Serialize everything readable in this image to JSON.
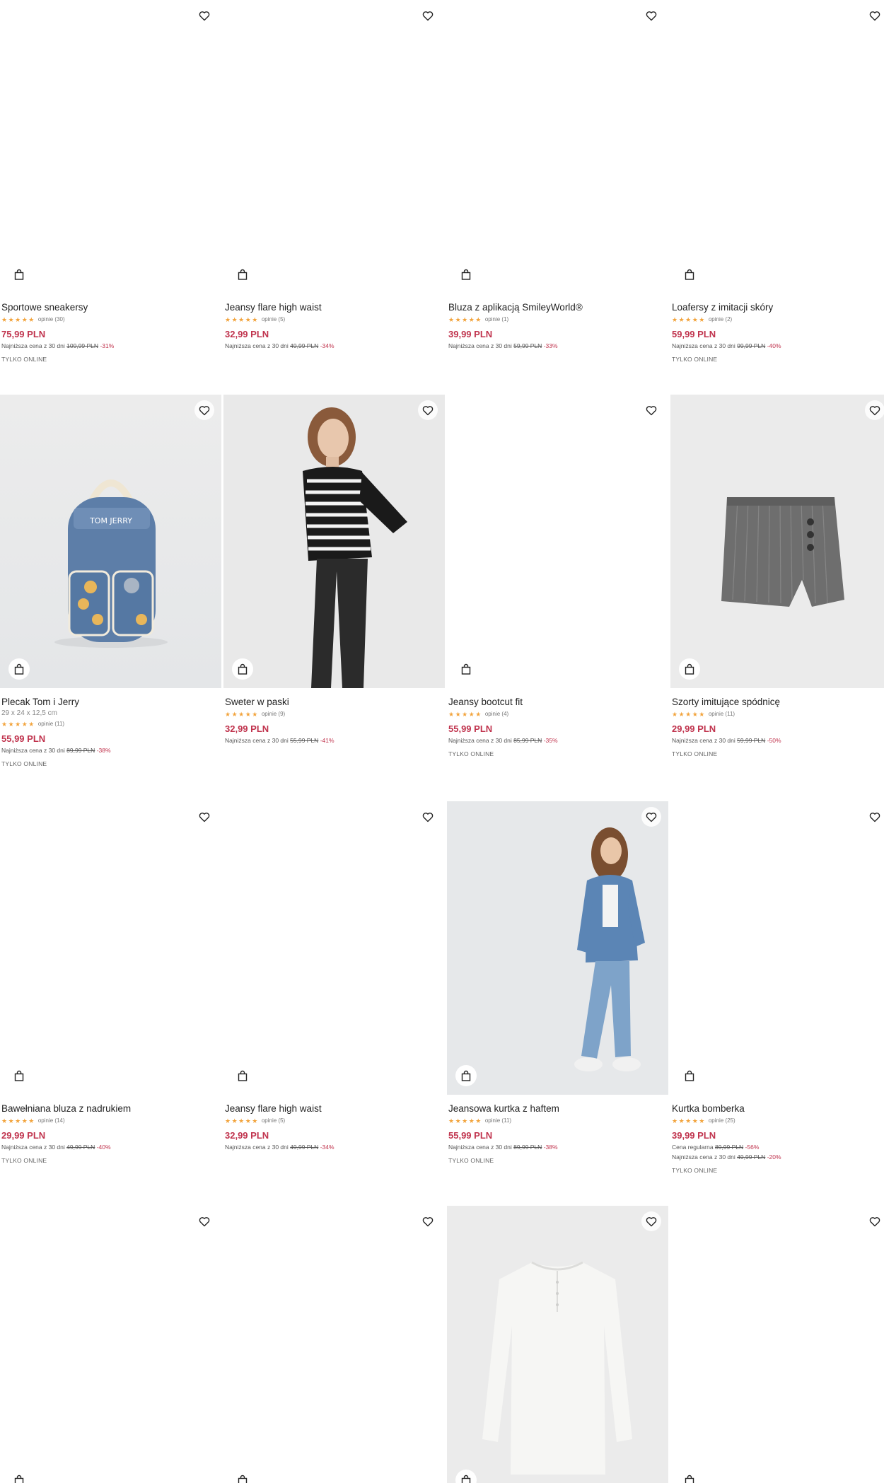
{
  "products": [
    {
      "name": "Sportowe sneakersy",
      "reviews": "opinie (30)",
      "price": "75,99 PLN",
      "lowest_label": "Najniższa cena z 30 dni",
      "lowest_price": "109,99 PLN",
      "lowest_pct": "-31%",
      "badge": "TYLKO ONLINE"
    },
    {
      "name": "Jeansy flare high waist",
      "reviews": "opinie (5)",
      "price": "32,99 PLN",
      "lowest_label": "Najniższa cena z 30 dni",
      "lowest_price": "49,99 PLN",
      "lowest_pct": "-34%"
    },
    {
      "name": "Bluza z aplikacją SmileyWorld®",
      "reviews": "opinie (1)",
      "price": "39,99 PLN",
      "lowest_label": "Najniższa cena z 30 dni",
      "lowest_price": "59,99 PLN",
      "lowest_pct": "-33%"
    },
    {
      "name": "Loafersy z imitacji skóry",
      "reviews": "opinie (2)",
      "price": "59,99 PLN",
      "lowest_label": "Najniższa cena z 30 dni",
      "lowest_price": "99,99 PLN",
      "lowest_pct": "-40%",
      "badge": "TYLKO ONLINE"
    },
    {
      "name": "Plecak Tom i Jerry",
      "dims": "29 x 24 x 12,5 cm",
      "reviews": "opinie (11)",
      "price": "55,99 PLN",
      "lowest_label": "Najniższa cena z 30 dni",
      "lowest_price": "89,99 PLN",
      "lowest_pct": "-38%",
      "badge": "TYLKO ONLINE"
    },
    {
      "name": "Sweter w paski",
      "reviews": "opinie (9)",
      "price": "32,99 PLN",
      "lowest_label": "Najniższa cena z 30 dni",
      "lowest_price": "55,99 PLN",
      "lowest_pct": "-41%"
    },
    {
      "name": "Jeansy bootcut fit",
      "reviews": "opinie (4)",
      "price": "55,99 PLN",
      "lowest_label": "Najniższa cena z 30 dni",
      "lowest_price": "85,99 PLN",
      "lowest_pct": "-35%",
      "badge": "TYLKO ONLINE"
    },
    {
      "name": "Szorty imitujące spódnicę",
      "reviews": "opinie (11)",
      "price": "29,99 PLN",
      "lowest_label": "Najniższa cena z 30 dni",
      "lowest_price": "59,99 PLN",
      "lowest_pct": "-50%",
      "badge": "TYLKO ONLINE"
    },
    {
      "name": "Bawełniana bluza z nadrukiem",
      "reviews": "opinie (14)",
      "price": "29,99 PLN",
      "lowest_label": "Najniższa cena z 30 dni",
      "lowest_price": "49,99 PLN",
      "lowest_pct": "-40%",
      "badge": "TYLKO ONLINE"
    },
    {
      "name": "Jeansy flare high waist",
      "reviews": "opinie (5)",
      "price": "32,99 PLN",
      "lowest_label": "Najniższa cena z 30 dni",
      "lowest_price": "49,99 PLN",
      "lowest_pct": "-34%"
    },
    {
      "name": "Jeansowa kurtka z haftem",
      "reviews": "opinie (11)",
      "price": "55,99 PLN",
      "lowest_label": "Najniższa cena z 30 dni",
      "lowest_price": "89,99 PLN",
      "lowest_pct": "-38%",
      "badge": "TYLKO ONLINE"
    },
    {
      "name": "Kurtka bomberka",
      "reviews": "opinie (25)",
      "price": "39,99 PLN",
      "regular_label": "Cena regularna",
      "regular_price": "89,99 PLN",
      "regular_pct": "-56%",
      "lowest_label": "Najniższa cena z 30 dni",
      "lowest_price": "49,99 PLN",
      "lowest_pct": "-20%",
      "badge": "TYLKO ONLINE"
    },
    {
      "photo": false
    },
    {
      "photo": false
    },
    {
      "photo": true
    },
    {
      "photo": false
    }
  ],
  "stars": "★★★★★",
  "icons": {
    "favorite": "heart-icon",
    "cart": "shopping-bag-icon"
  },
  "colors": {
    "price": "#c0334d",
    "stars": "#f2a33b",
    "photo_bg": "#ececec"
  }
}
